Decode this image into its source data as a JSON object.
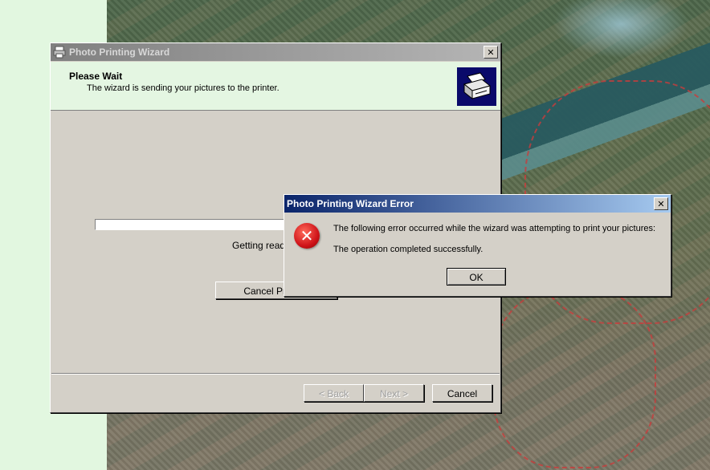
{
  "wizard": {
    "title": "Photo Printing Wizard",
    "header_title": "Please Wait",
    "header_subtitle": "The wizard is sending your pictures to the printer.",
    "status_text": "Getting ready to print...",
    "progress": 0,
    "cancel_printing_label": "Cancel Printing",
    "back_label": "< Back",
    "next_label": "Next >",
    "cancel_label": "Cancel",
    "close_glyph": "✕"
  },
  "error_dialog": {
    "title": "Photo Printing Wizard Error",
    "message": "The following error occurred while the wizard was attempting to print your pictures:",
    "detail": "The operation completed successfully.",
    "ok_label": "OK",
    "close_glyph": "✕",
    "icon": "error-icon",
    "icon_glyph": "✕"
  },
  "colors": {
    "active_title": "#0a246a",
    "inactive_title": "#808080",
    "dialog_face": "#d4d0c8",
    "header_bg": "#e4f6e2",
    "error_red": "#d0141a"
  }
}
